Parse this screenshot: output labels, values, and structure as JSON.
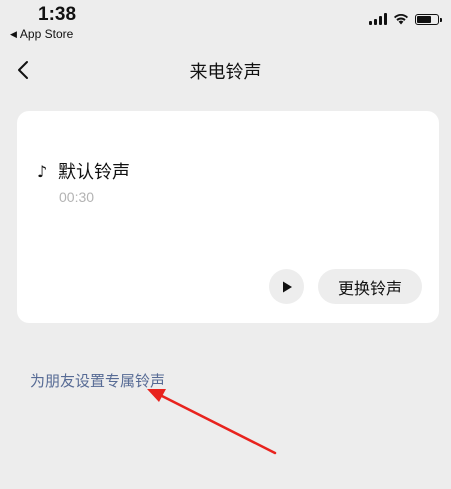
{
  "status_bar": {
    "time": "1:38",
    "back_app": "App Store",
    "back_glyph": "◀"
  },
  "nav": {
    "title": "来电铃声"
  },
  "ringtone": {
    "name": "默认铃声",
    "duration": "00:30",
    "note_glyph": "♪",
    "change_label": "更换铃声"
  },
  "friend_link": "为朋友设置专属铃声",
  "annotation": {
    "arrow_color": "#e8231e"
  },
  "colors": {
    "background": "#ededed",
    "card": "#ffffff",
    "link": "#576b95",
    "duration": "#b3b3b3"
  }
}
